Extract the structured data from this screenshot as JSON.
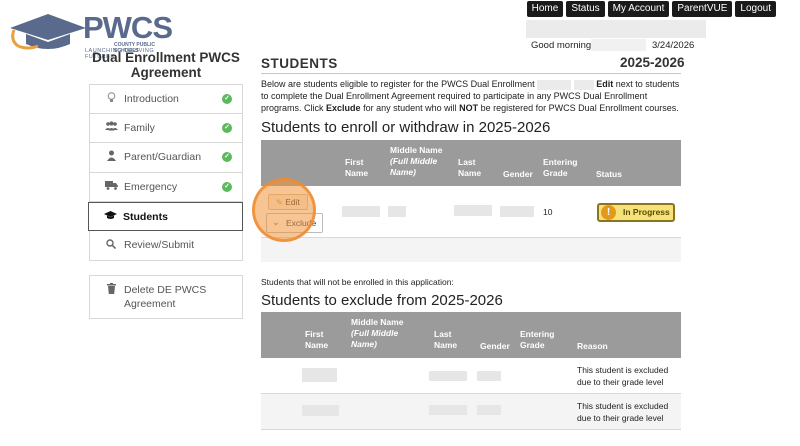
{
  "header": {
    "logo_text": "PWCS",
    "logo_sub1": "COUNTY PUBLIC SCHOOLS",
    "logo_sub2": "LAUNCHING THRIVING FUTURES",
    "nav": [
      "Home",
      "Status",
      "My Account",
      "ParentVUE",
      "Logout"
    ],
    "greeting": "Good morning,",
    "date": "3/24/2026"
  },
  "sidebar": {
    "title": "Dual Enrollment PWCS Agreement",
    "items": [
      {
        "label": "Introduction",
        "icon": "lightbulb-icon",
        "completed": true
      },
      {
        "label": "Family",
        "icon": "users-icon",
        "completed": true
      },
      {
        "label": "Parent/Guardian",
        "icon": "user-icon",
        "completed": true
      },
      {
        "label": "Emergency",
        "icon": "truck-icon",
        "completed": true
      },
      {
        "label": "Students",
        "icon": "graduation-cap-icon",
        "completed": false,
        "active": true
      },
      {
        "label": "Review/Submit",
        "icon": "search-icon",
        "completed": false
      }
    ],
    "delete_label": "Delete DE PWCS Agreement"
  },
  "main": {
    "title": "STUDENTS",
    "year": "2025-2026",
    "intro": {
      "part1": "Below are students eligible to register for the PWCS Dual Enrollment",
      "edit_word": "Edit",
      "part2": "next to students to complete the Dual Enrollment Agreement required to participate in any PWCS Dual Enrollment programs. Click",
      "exclude_word": "Exclude",
      "part3": "for any student who will",
      "not_word": "NOT",
      "part4": "be registered for PWCS Dual Enrollment courses."
    },
    "enroll_section": {
      "title": "Students to enroll or withdraw in 2025-2026",
      "headers": {
        "first_name": "First Name",
        "middle_name": "Middle Name",
        "middle_note": "(Full Middle Name)",
        "last_name": "Last Name",
        "gender": "Gender",
        "grade": "Entering Grade",
        "status": "Status"
      },
      "rows": [
        {
          "grade": "10",
          "status": "In Progress",
          "edit_label": "Edit",
          "exclude_label": "Exclude"
        }
      ]
    },
    "exclude_note": "Students that will not be enrolled in this application:",
    "exclude_section": {
      "title": "Students to exclude from 2025-2026",
      "headers": {
        "first_name": "First Name",
        "middle_name": "Middle Name",
        "middle_note": "(Full Middle Name)",
        "last_name": "Last Name",
        "gender": "Gender",
        "grade": "Entering Grade",
        "reason": "Reason"
      },
      "rows": [
        {
          "reason": "This student is excluded due to their grade level"
        },
        {
          "reason": "This student is excluded due to their grade level"
        }
      ]
    }
  },
  "colors": {
    "table_header": "#9b9b9b",
    "check_green": "#5cb85c",
    "status_badge": "#f6e27a",
    "highlight": "#f0963c"
  }
}
